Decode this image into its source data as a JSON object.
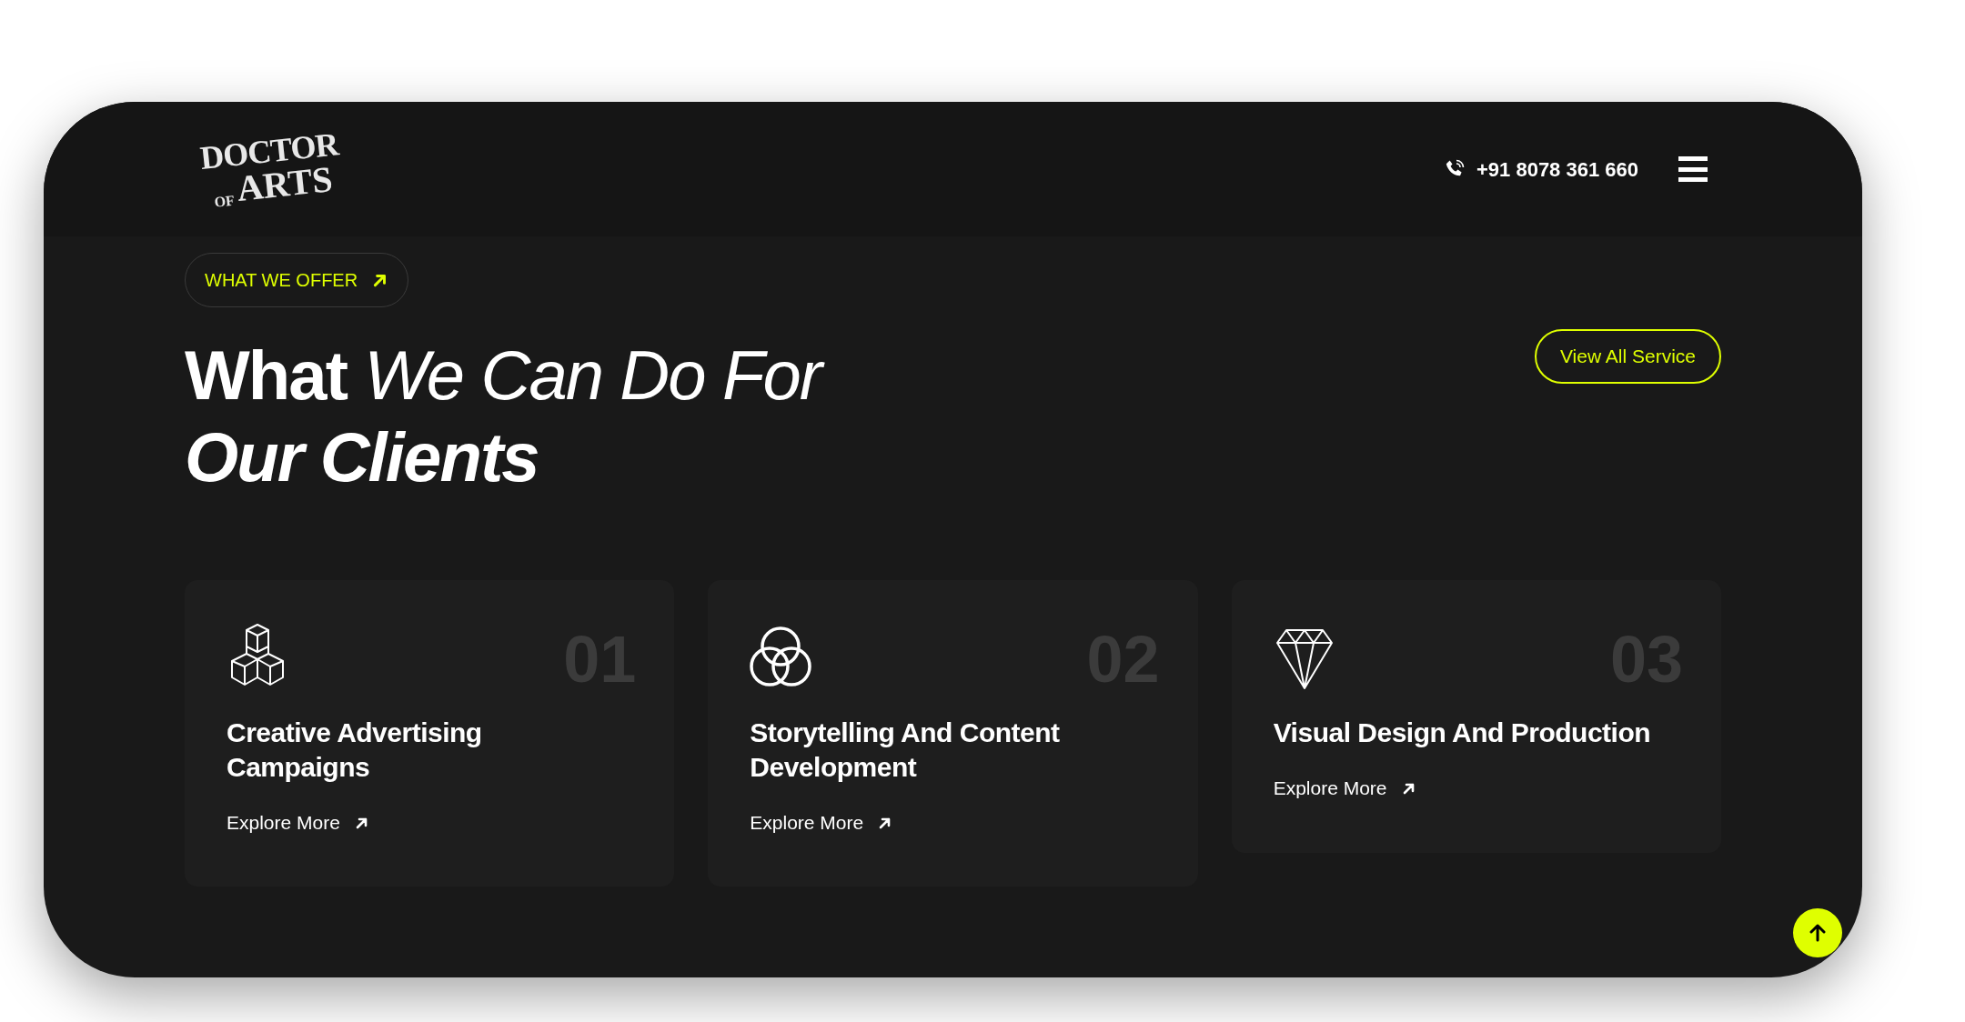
{
  "logo": {
    "lines": [
      "DOCTOR",
      "OF",
      "ARTS"
    ]
  },
  "header": {
    "phone": "+91 8078 361 660"
  },
  "section": {
    "tag": "WHAT WE OFFER",
    "heading": [
      "**What** *We Can Do For*",
      "*Our Clients*"
    ],
    "button": "View All Service"
  },
  "cards": [
    {
      "number": "01",
      "title": "Creative Advertising Campaigns",
      "link": "Explore More"
    },
    {
      "number": "02",
      "title": "Storytelling And Content Development",
      "link": "Explore More"
    },
    {
      "number": "03",
      "title": "Visual Design And Production",
      "link": "Explore More"
    }
  ]
}
